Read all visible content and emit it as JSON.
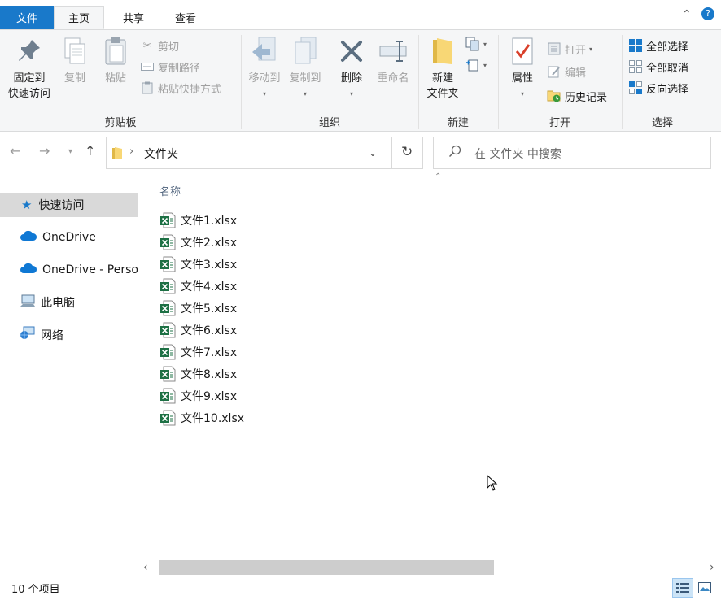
{
  "tabs": {
    "file": "文件",
    "home": "主页",
    "share": "共享",
    "view": "查看"
  },
  "ribbon": {
    "clipboard": {
      "label": "剪贴板",
      "pin_line1": "固定到",
      "pin_line2": "快速访问",
      "copy": "复制",
      "paste": "粘贴",
      "cut": "剪切",
      "copy_path": "复制路径",
      "paste_shortcut": "粘贴快捷方式"
    },
    "organize": {
      "label": "组织",
      "move_to": "移动到",
      "copy_to": "复制到",
      "delete": "删除",
      "rename": "重命名"
    },
    "new": {
      "label": "新建",
      "new_folder_line1": "新建",
      "new_folder_line2": "文件夹"
    },
    "open": {
      "label": "打开",
      "properties": "属性",
      "open": "打开",
      "edit": "编辑",
      "history": "历史记录"
    },
    "select": {
      "label": "选择",
      "select_all": "全部选择",
      "select_none": "全部取消",
      "invert": "反向选择"
    }
  },
  "address": {
    "path": "文件夹",
    "search_placeholder": "在 文件夹 中搜索"
  },
  "nav": [
    {
      "label": "快速访问",
      "icon": "star-icon"
    },
    {
      "label": "OneDrive",
      "icon": "cloud-icon"
    },
    {
      "label": "OneDrive - Perso",
      "icon": "cloud-icon"
    },
    {
      "label": "此电脑",
      "icon": "computer-icon"
    },
    {
      "label": "网络",
      "icon": "network-icon"
    }
  ],
  "list": {
    "column_name": "名称",
    "files": [
      "文件1.xlsx",
      "文件2.xlsx",
      "文件3.xlsx",
      "文件4.xlsx",
      "文件5.xlsx",
      "文件6.xlsx",
      "文件7.xlsx",
      "文件8.xlsx",
      "文件9.xlsx",
      "文件10.xlsx"
    ]
  },
  "status": {
    "count": "10 个项目"
  },
  "colors": {
    "accent": "#1979ca",
    "excel": "#1d7044",
    "folder": "#f8d775"
  }
}
